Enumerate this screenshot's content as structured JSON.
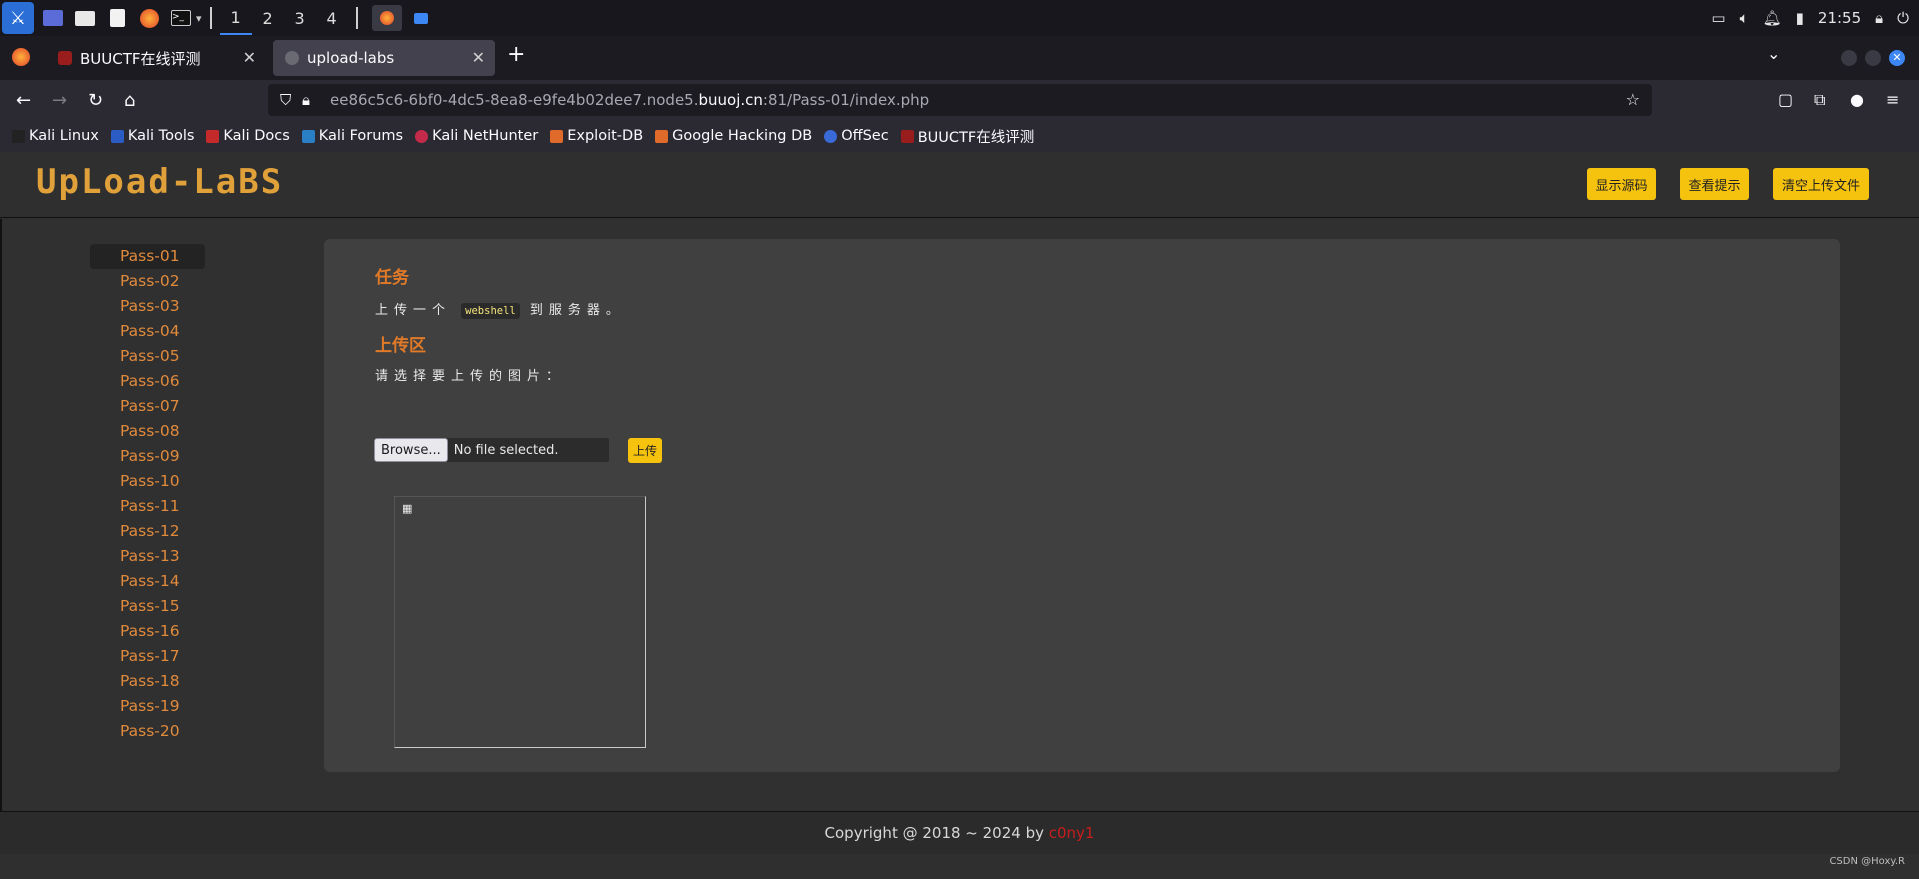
{
  "taskbar": {
    "workspaces": [
      "1",
      "2",
      "3",
      "4"
    ],
    "clock": "21:55",
    "tray_icons": [
      "display-icon",
      "volume-icon",
      "bell-icon",
      "battery-icon",
      "lock-icon",
      "power-icon"
    ]
  },
  "browser": {
    "tabs": [
      {
        "title": "BUUCTF在线评测",
        "active": false
      },
      {
        "title": "upload-labs",
        "active": true
      }
    ],
    "url_prefix": "ee86c5c6-6bf0-4dc5-8ea8-e9fe4b02dee7.node5.",
    "url_domain": "buuoj.cn",
    "url_suffix": ":81/Pass-01/index.php",
    "bookmarks": [
      "Kali Linux",
      "Kali Tools",
      "Kali Docs",
      "Kali Forums",
      "Kali NetHunter",
      "Exploit-DB",
      "Google Hacking DB",
      "OffSec",
      "BUUCTF在线评测"
    ]
  },
  "page": {
    "logo": "UpLoad-LaBS",
    "header_buttons": {
      "show_source": "显示源码",
      "view_hint": "查看提示",
      "clear_uploads": "清空上传文件"
    },
    "sidebar": [
      "Pass-01",
      "Pass-02",
      "Pass-03",
      "Pass-04",
      "Pass-05",
      "Pass-06",
      "Pass-07",
      "Pass-08",
      "Pass-09",
      "Pass-10",
      "Pass-11",
      "Pass-12",
      "Pass-13",
      "Pass-14",
      "Pass-15",
      "Pass-16",
      "Pass-17",
      "Pass-18",
      "Pass-19",
      "Pass-20"
    ],
    "task_heading": "任务",
    "task_text_before": "上传一个",
    "task_code": "webshell",
    "task_text_after": "到服务器。",
    "upload_heading": "上传区",
    "upload_prompt": "请选择要上传的图片：",
    "browse_label": "Browse...",
    "no_file": "No file selected.",
    "upload_button": "上传",
    "footer_text": "Copyright @ 2018 ~ 2024 by ",
    "footer_author": "c0ny1",
    "watermark": "CSDN @Hoxy.R"
  },
  "colors": {
    "accent": "#f5c30e",
    "link": "#e08a3c",
    "heading": "#e07a28"
  }
}
